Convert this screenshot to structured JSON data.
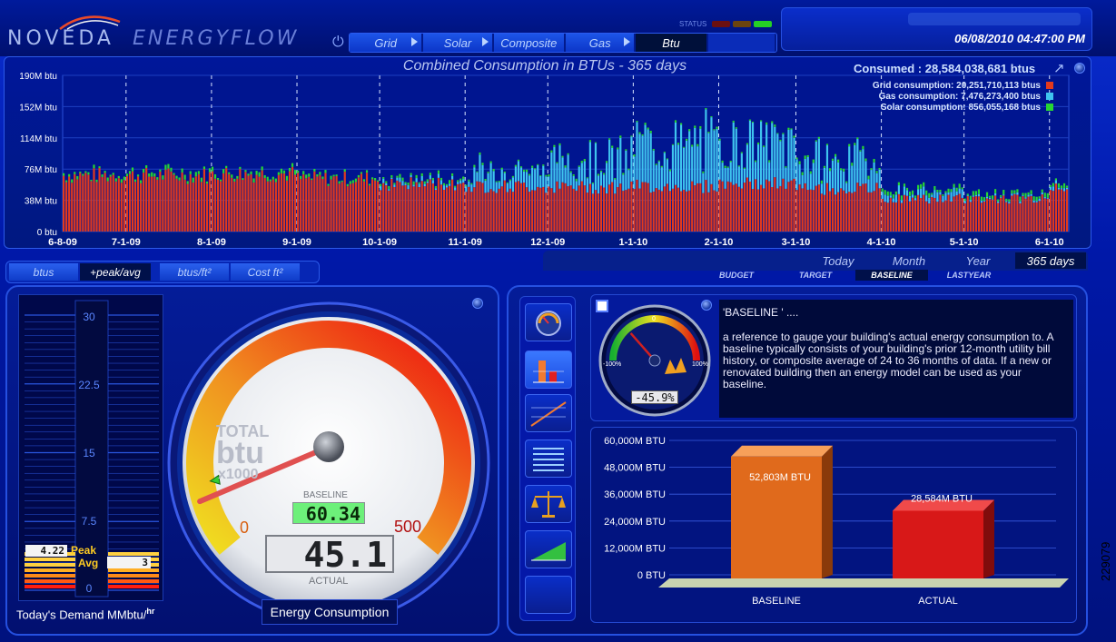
{
  "header": {
    "logo_left": "NOVEDA",
    "logo_right": "ENERGYFLOW",
    "status_label": "STATUS",
    "datetime": "06/08/2010 04:47:00 PM",
    "nav": [
      {
        "label": "Grid",
        "arrow": true,
        "selected": false
      },
      {
        "label": "Solar",
        "arrow": true,
        "selected": false
      },
      {
        "label": "Composite",
        "arrow": false,
        "selected": false
      },
      {
        "label": "Gas",
        "arrow": true,
        "selected": false
      },
      {
        "label": "Btu",
        "arrow": false,
        "selected": true
      }
    ],
    "status_colors": [
      "#6b1010",
      "#6b4410",
      "#25d025"
    ]
  },
  "chart_data": {
    "type": "bar",
    "title": "Combined Consumption in BTUs - 365 days",
    "consumed_label": "Consumed : 28,584,038,681 btus",
    "y_ticks": [
      "0 btu",
      "38M btu",
      "76M btu",
      "114M btu",
      "152M btu",
      "190M btu"
    ],
    "ylim": [
      0,
      190
    ],
    "x_ticks": [
      "6-8-09",
      "7-1-09",
      "8-1-09",
      "9-1-09",
      "10-1-09",
      "11-1-09",
      "12-1-09",
      "1-1-10",
      "2-1-10",
      "3-1-10",
      "4-1-10",
      "5-1-10",
      "6-1-10"
    ],
    "x_tick_days": [
      0,
      23,
      54,
      85,
      115,
      146,
      176,
      207,
      238,
      266,
      297,
      327,
      358
    ],
    "n_days": 365,
    "legend": [
      {
        "label": "Grid consumption: 20,251,710,113 btus",
        "color": "#e23a1d"
      },
      {
        "label": "Gas consumption: 7,476,273,400 btus",
        "color": "#3fc4ee"
      },
      {
        "label": "Solar consumption: 856,055,168 btus",
        "color": "#27d632"
      }
    ],
    "series_monthly_avg": {
      "months": [
        "Jun-09",
        "Jul-09",
        "Aug-09",
        "Sep-09",
        "Oct-09",
        "Nov-09",
        "Dec-09",
        "Jan-10",
        "Feb-10",
        "Mar-10",
        "Apr-10",
        "May-10",
        "Jun-10"
      ],
      "grid": [
        68,
        68,
        70,
        64,
        58,
        55,
        54,
        55,
        58,
        52,
        40,
        40,
        55
      ],
      "gas": [
        0,
        0,
        0,
        0,
        4,
        22,
        38,
        58,
        55,
        38,
        8,
        2,
        4
      ],
      "solar": [
        3,
        4,
        4,
        3,
        3,
        2,
        2,
        2,
        2,
        3,
        4,
        4,
        4
      ]
    }
  },
  "range_tabs": [
    "Today",
    "Month",
    "Year",
    "365 days"
  ],
  "range_selected": "365 days",
  "sub_tabs": [
    "BUDGET",
    "TARGET",
    "BASELINE",
    "LASTYEAR"
  ],
  "sub_selected": "BASELINE",
  "unit_tabs": [
    "btus",
    "+peak/avg",
    "btus/ft²",
    "Cost ft²"
  ],
  "demand": {
    "label": "Today's Demand MMbtu/hr",
    "label_main": "Today's Demand MMbtu/",
    "label_sup": "hr",
    "ticks": [
      "30",
      "22.5",
      "15",
      "7.5",
      "0"
    ],
    "peak_value": "4.22",
    "peak_label": "Peak",
    "avg_value": "3",
    "avg_label": "Avg",
    "max": 30
  },
  "gauge": {
    "title_line1": "TOTAL",
    "title_line2": "btu",
    "title_line3": "x1000",
    "min_label": "0",
    "max_label": "500",
    "baseline_label": "BASELINE",
    "baseline_value": "60.34",
    "actual_value": "45.1",
    "actual_label": "ACTUAL",
    "footer": "Energy Consumption",
    "max": 500
  },
  "mini_gauge": {
    "value_text": "-45.9%",
    "min_label": "-100%",
    "zero_label": "0",
    "max_label": "100%",
    "value": -45.9
  },
  "description": {
    "title": "'BASELINE ' ....",
    "body": "a reference to gauge your building's actual energy consumption to. A baseline typically consists of your building's prior 12-month utility bill history, or composite average of 24 to 36 months of data.  If a new or renovated building then an energy model can be used as your baseline."
  },
  "comparison_chart": {
    "type": "bar",
    "y_ticks": [
      "0 BTU",
      "12,000M BTU",
      "24,000M BTU",
      "36,000M BTU",
      "48,000M BTU",
      "60,000M BTU"
    ],
    "ylim": [
      0,
      60000
    ],
    "categories": [
      "BASELINE",
      "ACTUAL"
    ],
    "values": [
      52803,
      28584
    ],
    "value_labels": [
      "52,803M BTU",
      "28,584M BTU"
    ],
    "colors": [
      "#e06a1c",
      "#d81818"
    ]
  },
  "side_id": "229079"
}
